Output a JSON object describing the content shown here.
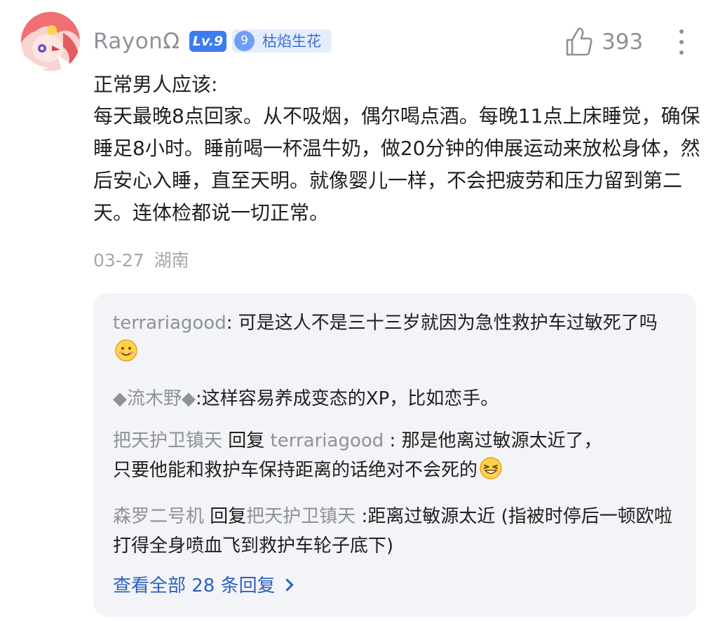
{
  "comment": {
    "username": "RayonΩ",
    "level_badge": "Lv.9",
    "fan_badge_level": "9",
    "fan_badge_name": "枯焰生花",
    "like_count": "393",
    "heading": "正常男人应该:",
    "body": "每天最晚8点回家。从不吸烟，偶尔喝点酒。每晚11点上床睡觉，确保睡足8小时。睡前喝一杯温牛奶，做20分钟的伸展运动来放松身体，然后安心入睡，直至天明。就像婴儿一样，不会把疲劳和压力留到第二天。连体检都说一切正常。",
    "date": "03-27",
    "location": "湖南"
  },
  "replies": [
    {
      "user": "terrariagood",
      "reply_word": "",
      "reply_to": "",
      "separator": ": ",
      "text": "可是这人不是三十三岁就因为急性救护车过敏死了吗",
      "emoji": "smile-emoji"
    },
    {
      "user": "◆流木野◆",
      "reply_word": "",
      "reply_to": "",
      "separator": ":",
      "text": "这样容易养成变态的XP，比如恋手。",
      "emoji": ""
    },
    {
      "user": "把天护卫镇天",
      "reply_word": " 回复 ",
      "reply_to": "terrariagood",
      "separator": " : ",
      "text": "那是他离过敏源太近了，\n只要他能和救护车保持距离的话绝对不会死的",
      "emoji": "grin-emoji"
    },
    {
      "user": "森罗二号机",
      "reply_word": " 回复",
      "reply_to": "把天护卫镇天",
      "separator": " :",
      "text": "距离过敏源太近 (指被时停后一顿欧啦打得全身喷血飞到救护车轮子底下)",
      "emoji": ""
    }
  ],
  "view_all_label": "查看全部 28 条回复",
  "colors": {
    "username": "#8e9197",
    "level_badge": "#3b7cf0",
    "fan_badge_bg": "#e4edfd",
    "link": "#2f5fc4",
    "reply_panel_bg": "#f3f4f7"
  }
}
